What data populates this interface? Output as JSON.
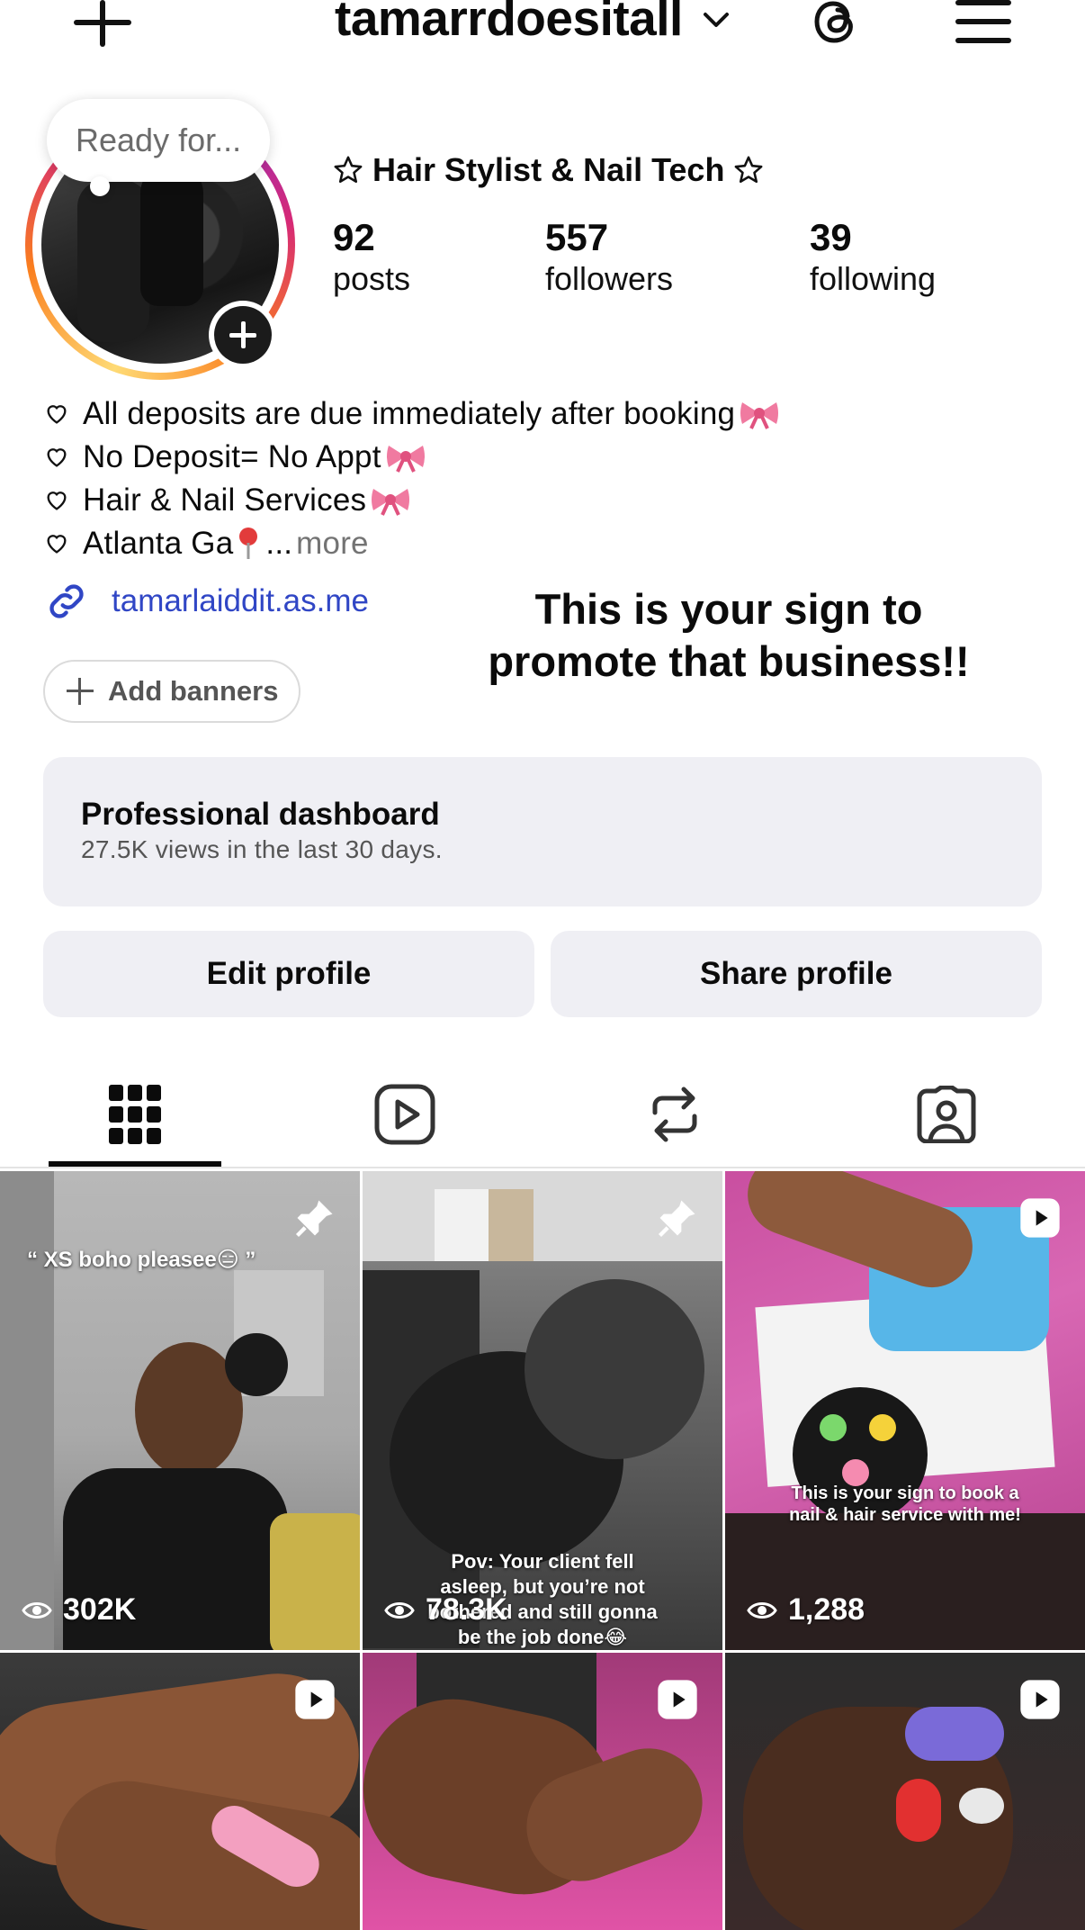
{
  "header": {
    "username": "tamarrdoesitall"
  },
  "note": {
    "text": "Ready for..."
  },
  "profile": {
    "category": "Hair Stylist & Nail Tech",
    "stats": [
      {
        "value": "92",
        "label": "posts"
      },
      {
        "value": "557",
        "label": "followers"
      },
      {
        "value": "39",
        "label": "following"
      }
    ],
    "bio": [
      "All deposits are due immediately after booking",
      "No Deposit= No Appt",
      "Hair & Nail Services",
      "Atlanta Ga"
    ],
    "bio_ellipsis": "...",
    "bio_more": "more",
    "link": "tamarlaiddit.as.me",
    "add_banners": "Add banners"
  },
  "promo_text": "This is your sign to promote that business!!",
  "dashboard": {
    "title": "Professional dashboard",
    "subtitle": "27.5K views in the last 30 days."
  },
  "buttons": {
    "edit": "Edit profile",
    "share": "Share profile"
  },
  "tabs": [
    {
      "icon": "grid-icon",
      "active": true
    },
    {
      "icon": "reels-icon",
      "active": false
    },
    {
      "icon": "reposts-icon",
      "active": false
    },
    {
      "icon": "tagged-icon",
      "active": false
    }
  ],
  "posts": [
    {
      "caption": "“ XS boho pleasee😑 ”",
      "views": "302K",
      "badge": "pin-icon"
    },
    {
      "caption": "Pov: Your client fell asleep, but you’re not bothered and still gonna be the job done😂",
      "views": "78.3K",
      "badge": "pin-icon"
    },
    {
      "caption": "This is your sign to book a nail & hair service with me!",
      "views": "1,288",
      "badge": "reel-icon"
    },
    {
      "caption": "",
      "views": "",
      "badge": "reel-icon"
    },
    {
      "caption": "",
      "views": "",
      "badge": "reel-icon"
    },
    {
      "caption": "",
      "views": "",
      "badge": "reel-icon"
    }
  ],
  "colors": {
    "link": "#3046c5",
    "button_bg": "#efeff4",
    "muted": "#737373"
  }
}
